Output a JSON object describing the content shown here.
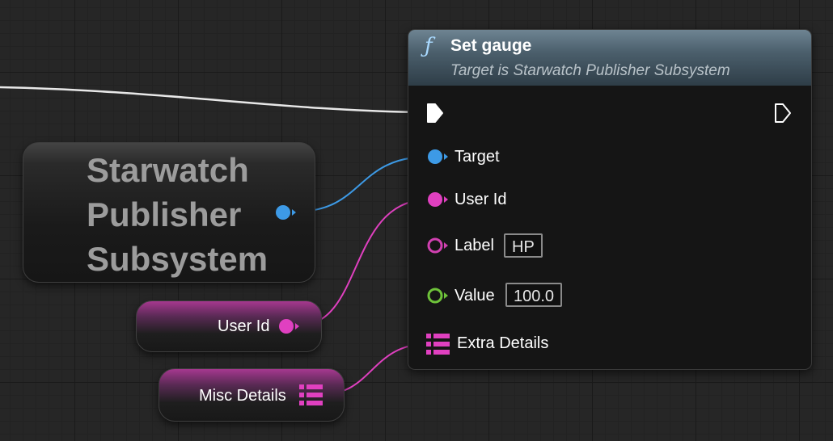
{
  "function_node": {
    "icon": "function-icon",
    "title": "Set gauge",
    "subtitle": "Target is Starwatch Publisher Subsystem",
    "header_color": "#4b5f6c",
    "pins": [
      {
        "name": "exec-in",
        "label": "",
        "type": "exec"
      },
      {
        "name": "exec-out",
        "label": "",
        "type": "exec"
      },
      {
        "name": "target",
        "label": "Target",
        "type": "object",
        "color": "#3d9ae6"
      },
      {
        "name": "user-id",
        "label": "User Id",
        "type": "struct",
        "color": "#e040c0"
      },
      {
        "name": "label",
        "label": "Label",
        "type": "text",
        "color": "#d040b0",
        "default": "HP"
      },
      {
        "name": "value",
        "label": "Value",
        "type": "float",
        "color": "#6ec23a",
        "default": "100.0"
      },
      {
        "name": "extra-details",
        "label": "Extra Details",
        "type": "struct-array",
        "color": "#e040c0"
      }
    ]
  },
  "variable_nodes": {
    "subsystem": {
      "lines": [
        "Starwatch",
        "Publisher",
        "Subsystem"
      ],
      "pin_color": "#3d9ae6"
    },
    "user_id": {
      "label": "User Id",
      "pin_color": "#e040c0"
    },
    "misc_details": {
      "label": "Misc Details",
      "pin_color": "#e040c0"
    }
  }
}
